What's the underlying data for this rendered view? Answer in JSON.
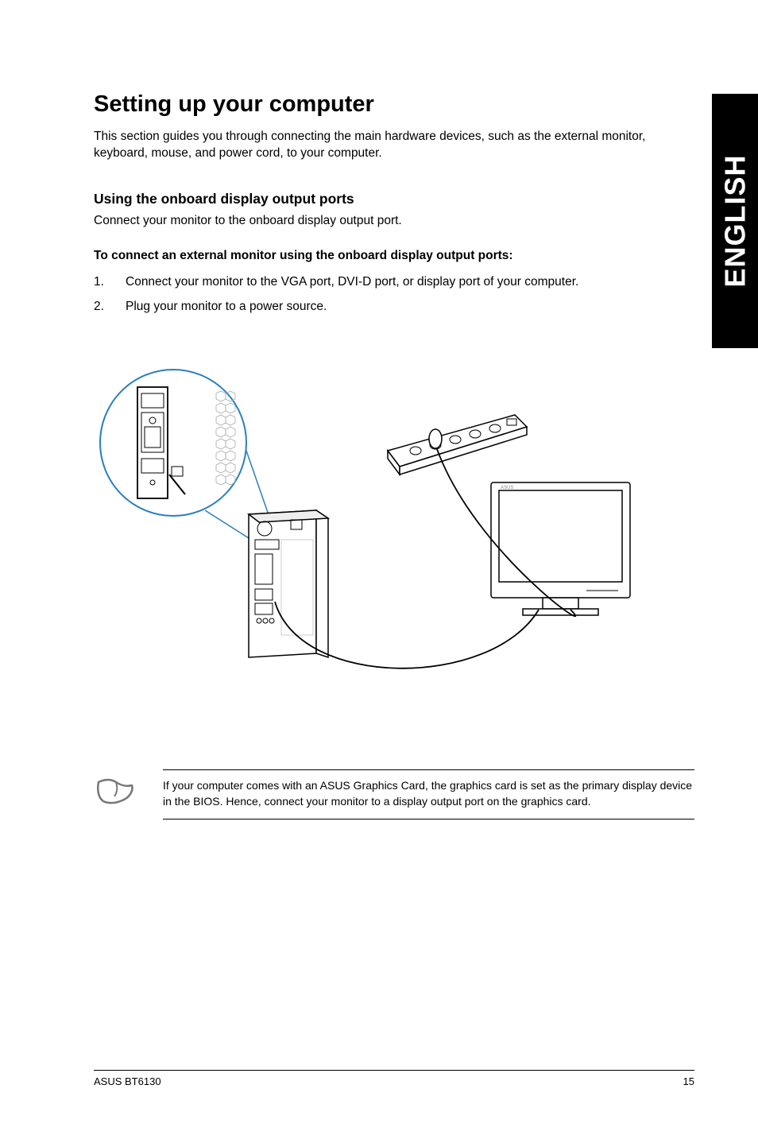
{
  "sideTab": "ENGLISH",
  "heading": "Setting up your computer",
  "intro": "This section guides you through connecting the main hardware devices, such as the external monitor, keyboard, mouse, and power cord, to your computer.",
  "subheading": "Using the onboard display output ports",
  "subtext": "Connect your monitor to the onboard display output port.",
  "procTitle": "To connect an external monitor using the onboard display output ports:",
  "steps": [
    "Connect your monitor to the VGA port, DVI-D port, or display port of your computer.",
    "Plug your monitor to a power source."
  ],
  "note": "If your computer comes with an ASUS Graphics Card, the graphics card is set as the primary display device in the BIOS. Hence, connect your monitor to a display output port on the graphics card.",
  "footerLeft": "ASUS BT6130",
  "footerRight": "15"
}
